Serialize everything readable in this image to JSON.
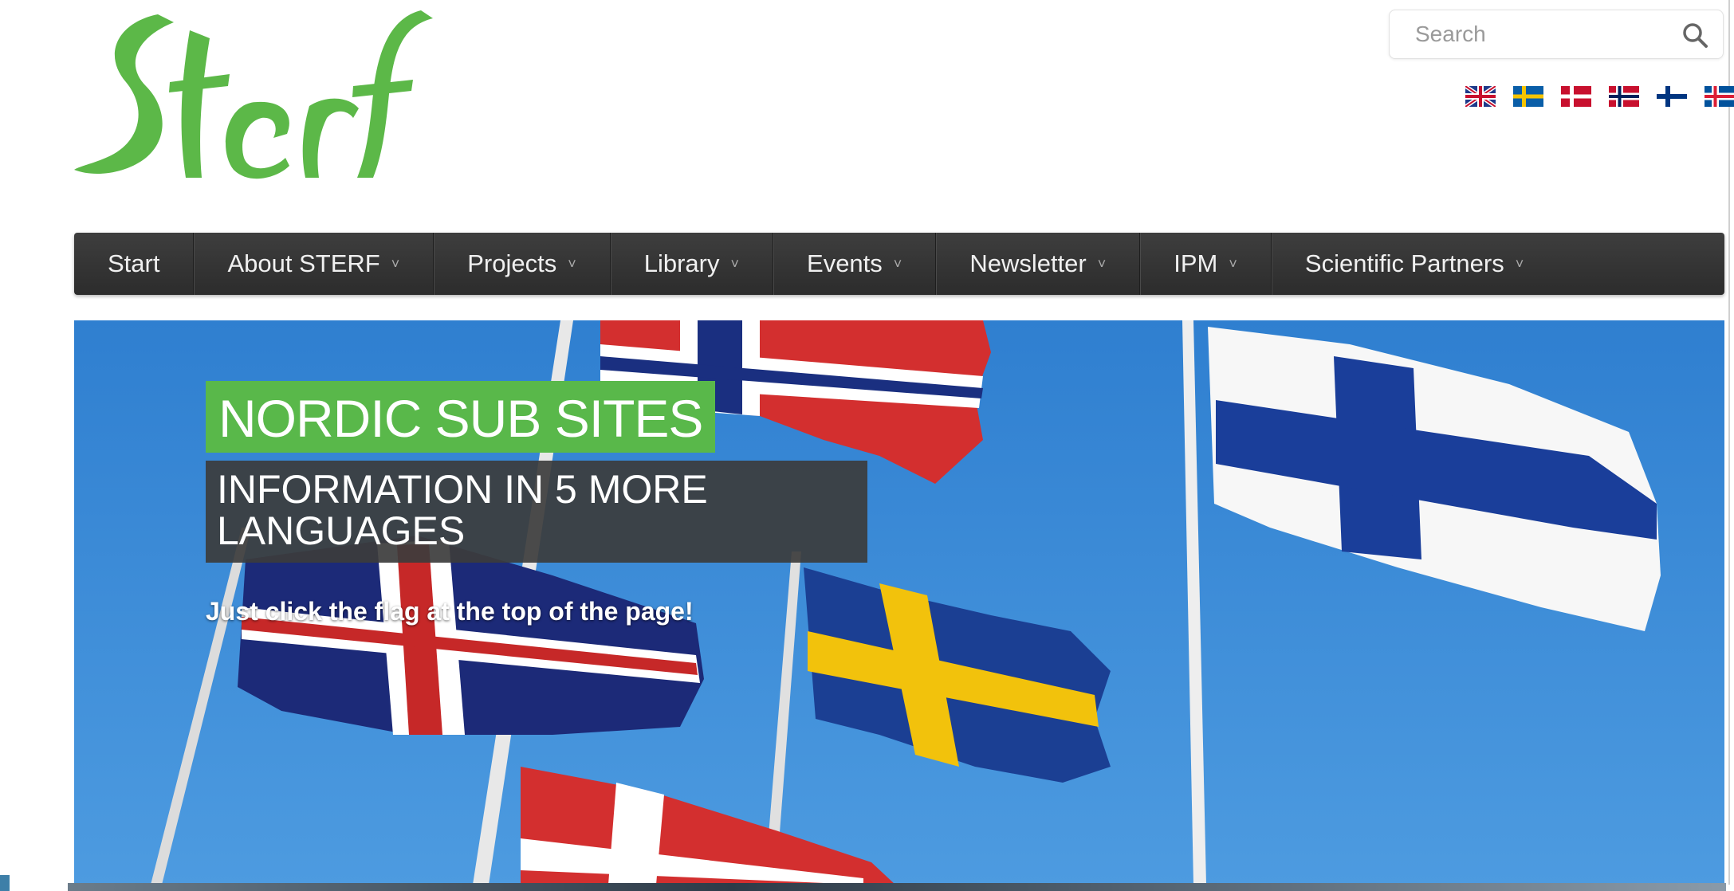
{
  "logo": {
    "text": "Sterf",
    "color": "#5cb848"
  },
  "search": {
    "placeholder": "Search"
  },
  "languages": [
    "English",
    "Svenska",
    "Dansk",
    "Norsk",
    "Suomi",
    "Íslenska"
  ],
  "nav": {
    "items": [
      {
        "label": "Start",
        "has_dropdown": false
      },
      {
        "label": "About STERF",
        "has_dropdown": true
      },
      {
        "label": "Projects",
        "has_dropdown": true
      },
      {
        "label": "Library",
        "has_dropdown": true
      },
      {
        "label": "Events",
        "has_dropdown": true
      },
      {
        "label": "Newsletter",
        "has_dropdown": true
      },
      {
        "label": "IPM",
        "has_dropdown": true
      },
      {
        "label": "Scientific Partners",
        "has_dropdown": true
      }
    ],
    "dropdown_glyph": "˅"
  },
  "hero": {
    "title": "NORDIC SUB SITES",
    "subtitle_line1": "INFORMATION IN 5 MORE",
    "subtitle_line2": "LANGUAGES",
    "text": "Just click the flag at the top of the page!"
  },
  "colors": {
    "accent_green": "#59b84a",
    "nav_bg": "#333333",
    "sky": "#3d8ad6"
  }
}
